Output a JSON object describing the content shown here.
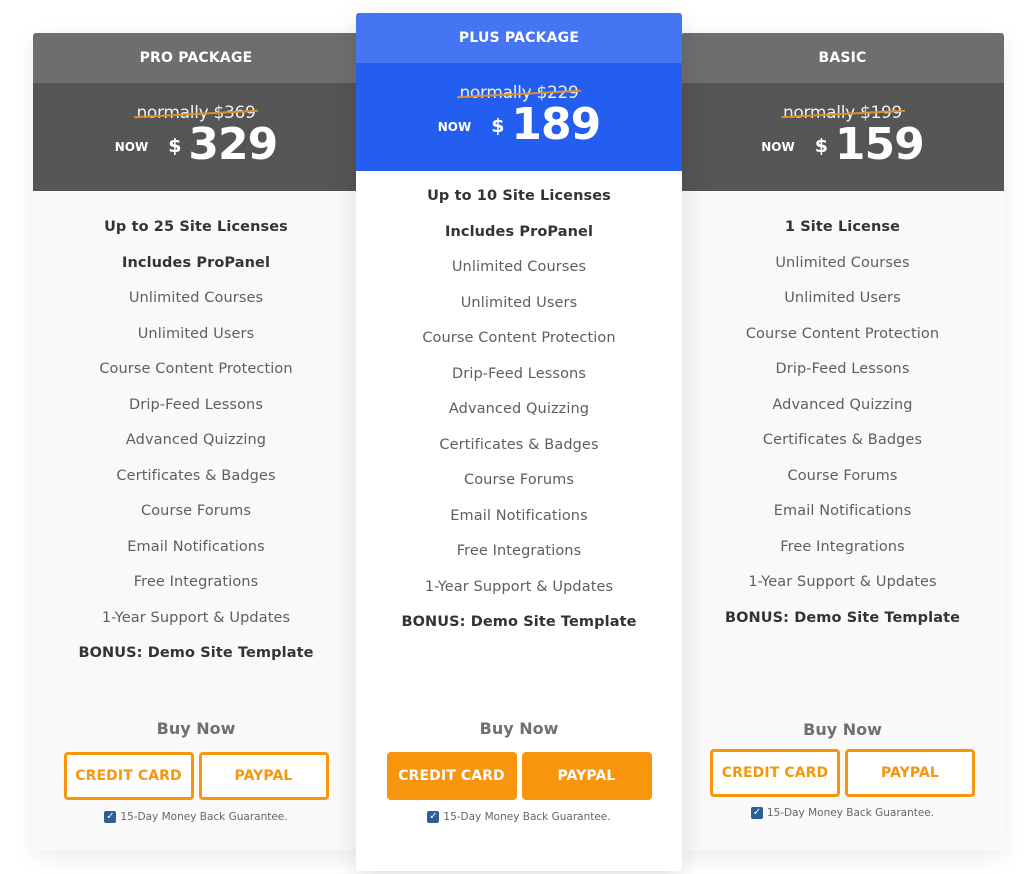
{
  "plans": [
    {
      "name": "PRO PACKAGE",
      "normally": "normally $369",
      "now_label": "NOW",
      "currency": "$",
      "price": "329",
      "features": [
        {
          "text": "Up to 25 Site Licenses",
          "bold": true
        },
        {
          "text": "Includes ProPanel",
          "bold": true
        },
        {
          "text": "Unlimited Courses",
          "bold": false
        },
        {
          "text": "Unlimited Users",
          "bold": false
        },
        {
          "text": "Course Content Protection",
          "bold": false
        },
        {
          "text": "Drip-Feed Lessons",
          "bold": false
        },
        {
          "text": "Advanced Quizzing",
          "bold": false
        },
        {
          "text": "Certificates & Badges",
          "bold": false
        },
        {
          "text": "Course Forums",
          "bold": false
        },
        {
          "text": "Email Notifications",
          "bold": false
        },
        {
          "text": "Free Integrations",
          "bold": false
        },
        {
          "text": "1-Year Support & Updates",
          "bold": false
        },
        {
          "text": "BONUS: Demo Site Template",
          "bold": true
        }
      ],
      "buy_label": "Buy Now",
      "credit_card_label": "CREDIT CARD",
      "paypal_label": "PAYPAL",
      "guarantee": "15-Day Money Back Guarantee.",
      "guarantee_checked": true
    },
    {
      "name": "PLUS PACKAGE",
      "normally": "normally $229",
      "now_label": "NOW",
      "currency": "$",
      "price": "189",
      "features": [
        {
          "text": "Up to 10 Site Licenses",
          "bold": true
        },
        {
          "text": "Includes ProPanel",
          "bold": true
        },
        {
          "text": "Unlimited Courses",
          "bold": false
        },
        {
          "text": "Unlimited Users",
          "bold": false
        },
        {
          "text": "Course Content Protection",
          "bold": false
        },
        {
          "text": "Drip-Feed Lessons",
          "bold": false
        },
        {
          "text": "Advanced Quizzing",
          "bold": false
        },
        {
          "text": "Certificates & Badges",
          "bold": false
        },
        {
          "text": "Course Forums",
          "bold": false
        },
        {
          "text": "Email Notifications",
          "bold": false
        },
        {
          "text": "Free Integrations",
          "bold": false
        },
        {
          "text": "1-Year Support & Updates",
          "bold": false
        },
        {
          "text": "BONUS: Demo Site Template",
          "bold": true
        }
      ],
      "buy_label": "Buy Now",
      "credit_card_label": "CREDIT CARD",
      "paypal_label": "PAYPAL",
      "guarantee": "15-Day Money Back Guarantee.",
      "guarantee_checked": true
    },
    {
      "name": "BASIC",
      "normally": "normally $199",
      "now_label": "NOW",
      "currency": "$",
      "price": "159",
      "features": [
        {
          "text": "1 Site License",
          "bold": true
        },
        {
          "text": "Unlimited Courses",
          "bold": false
        },
        {
          "text": "Unlimited Users",
          "bold": false
        },
        {
          "text": "Course Content Protection",
          "bold": false
        },
        {
          "text": "Drip-Feed Lessons",
          "bold": false
        },
        {
          "text": "Advanced Quizzing",
          "bold": false
        },
        {
          "text": "Certificates & Badges",
          "bold": false
        },
        {
          "text": "Course Forums",
          "bold": false
        },
        {
          "text": "Email Notifications",
          "bold": false
        },
        {
          "text": "Free Integrations",
          "bold": false
        },
        {
          "text": "1-Year Support & Updates",
          "bold": false
        },
        {
          "text": "BONUS: Demo Site Template",
          "bold": true
        }
      ],
      "buy_label": "Buy Now",
      "credit_card_label": "CREDIT CARD",
      "paypal_label": "PAYPAL",
      "guarantee": "15-Day Money Back Guarantee.",
      "guarantee_checked": true
    }
  ],
  "colors": {
    "pro_header": "#6e6e6e",
    "pro_price_bg": "#555555",
    "plus_header": "#4575f2",
    "plus_price_bg": "#235ef0",
    "accent_orange": "#f7960d",
    "strike_line": "#d9912d",
    "checkbox_blue": "#2c5e98"
  }
}
